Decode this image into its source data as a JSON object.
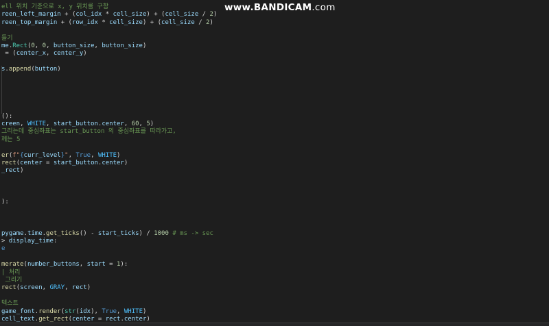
{
  "watermark": {
    "brand": "www.BANDICAM",
    "suffix": ".com"
  },
  "colors": {
    "background": "#1e1e1e",
    "keyword": "#c586c0",
    "function": "#dcdcaa",
    "variable": "#9cdcfe",
    "constant": "#4fc1ff",
    "number": "#b5cea8",
    "string": "#ce9178",
    "comment": "#6a9955",
    "bool": "#569cd6"
  },
  "code_lines": [
    {
      "segments": [
        {
          "t": "ell 위치 기준으로 x, y 위치를 구함",
          "c": "cmt"
        }
      ]
    },
    {
      "segments": [
        {
          "t": "reen_left_margin",
          "c": "var"
        },
        {
          "t": " + (",
          "c": "op"
        },
        {
          "t": "col_idx",
          "c": "var"
        },
        {
          "t": " * ",
          "c": "op"
        },
        {
          "t": "cell_size",
          "c": "var"
        },
        {
          "t": ") + (",
          "c": "op"
        },
        {
          "t": "cell_size",
          "c": "var"
        },
        {
          "t": " / ",
          "c": "op"
        },
        {
          "t": "2",
          "c": "num"
        },
        {
          "t": ")",
          "c": "op"
        }
      ]
    },
    {
      "segments": [
        {
          "t": "reen_top_margin",
          "c": "var"
        },
        {
          "t": " + (",
          "c": "op"
        },
        {
          "t": "row_idx",
          "c": "var"
        },
        {
          "t": " * ",
          "c": "op"
        },
        {
          "t": "cell_size",
          "c": "var"
        },
        {
          "t": ") + (",
          "c": "op"
        },
        {
          "t": "cell_size",
          "c": "var"
        },
        {
          "t": " / ",
          "c": "op"
        },
        {
          "t": "2",
          "c": "num"
        },
        {
          "t": ")",
          "c": "op"
        }
      ]
    },
    {
      "segments": []
    },
    {
      "segments": [
        {
          "t": "들기",
          "c": "cmt"
        }
      ]
    },
    {
      "segments": [
        {
          "t": "me",
          "c": "var"
        },
        {
          "t": ".",
          "c": "op"
        },
        {
          "t": "Rect",
          "c": "cls"
        },
        {
          "t": "(",
          "c": "op"
        },
        {
          "t": "0",
          "c": "num"
        },
        {
          "t": ", ",
          "c": "op"
        },
        {
          "t": "0",
          "c": "num"
        },
        {
          "t": ", ",
          "c": "op"
        },
        {
          "t": "button_size",
          "c": "var"
        },
        {
          "t": ", ",
          "c": "op"
        },
        {
          "t": "button_size",
          "c": "var"
        },
        {
          "t": ")",
          "c": "op"
        }
      ]
    },
    {
      "segments": [
        {
          "t": " = (",
          "c": "op"
        },
        {
          "t": "center_x",
          "c": "var"
        },
        {
          "t": ", ",
          "c": "op"
        },
        {
          "t": "center_y",
          "c": "var"
        },
        {
          "t": ")",
          "c": "op"
        }
      ]
    },
    {
      "segments": []
    },
    {
      "segments": [
        {
          "t": "s",
          "c": "var"
        },
        {
          "t": ".",
          "c": "op"
        },
        {
          "t": "append",
          "c": "fn"
        },
        {
          "t": "(",
          "c": "op"
        },
        {
          "t": "button",
          "c": "var"
        },
        {
          "t": ")",
          "c": "op"
        }
      ]
    },
    {
      "segments": []
    },
    {
      "segments": []
    },
    {
      "segments": []
    },
    {
      "segments": []
    },
    {
      "segments": []
    },
    {
      "segments": [
        {
          "t": "():",
          "c": "op"
        }
      ]
    },
    {
      "segments": [
        {
          "t": "creen",
          "c": "var"
        },
        {
          "t": ", ",
          "c": "op"
        },
        {
          "t": "WHITE",
          "c": "const"
        },
        {
          "t": ", ",
          "c": "op"
        },
        {
          "t": "start_button",
          "c": "var"
        },
        {
          "t": ".",
          "c": "op"
        },
        {
          "t": "center",
          "c": "var"
        },
        {
          "t": ", ",
          "c": "op"
        },
        {
          "t": "60",
          "c": "num"
        },
        {
          "t": ", ",
          "c": "op"
        },
        {
          "t": "5",
          "c": "num"
        },
        {
          "t": ")",
          "c": "op"
        }
      ]
    },
    {
      "segments": [
        {
          "t": "그리는데 중심좌표는 start_button 의 중심좌표를 따라가고,",
          "c": "cmt"
        }
      ]
    },
    {
      "segments": [
        {
          "t": "께는 5",
          "c": "cmt"
        }
      ]
    },
    {
      "segments": []
    },
    {
      "segments": [
        {
          "t": "er",
          "c": "fn"
        },
        {
          "t": "(",
          "c": "op"
        },
        {
          "t": "f\"",
          "c": "str"
        },
        {
          "t": "{",
          "c": "bool"
        },
        {
          "t": "curr_level",
          "c": "var"
        },
        {
          "t": "}",
          "c": "bool"
        },
        {
          "t": "\"",
          "c": "str"
        },
        {
          "t": ", ",
          "c": "op"
        },
        {
          "t": "True",
          "c": "bool"
        },
        {
          "t": ", ",
          "c": "op"
        },
        {
          "t": "WHITE",
          "c": "const"
        },
        {
          "t": ")",
          "c": "op"
        }
      ]
    },
    {
      "segments": [
        {
          "t": "rect",
          "c": "fn"
        },
        {
          "t": "(",
          "c": "op"
        },
        {
          "t": "center",
          "c": "var"
        },
        {
          "t": " = ",
          "c": "op"
        },
        {
          "t": "start_button",
          "c": "var"
        },
        {
          "t": ".",
          "c": "op"
        },
        {
          "t": "center",
          "c": "var"
        },
        {
          "t": ")",
          "c": "op"
        }
      ]
    },
    {
      "segments": [
        {
          "t": "_rect",
          "c": "var"
        },
        {
          "t": ")",
          "c": "op"
        }
      ]
    },
    {
      "segments": []
    },
    {
      "segments": []
    },
    {
      "segments": []
    },
    {
      "segments": [
        {
          "t": "):",
          "c": "op"
        }
      ]
    },
    {
      "segments": []
    },
    {
      "segments": []
    },
    {
      "segments": []
    },
    {
      "segments": [
        {
          "t": "pygame",
          "c": "var"
        },
        {
          "t": ".",
          "c": "op"
        },
        {
          "t": "time",
          "c": "var"
        },
        {
          "t": ".",
          "c": "op"
        },
        {
          "t": "get_ticks",
          "c": "fn"
        },
        {
          "t": "() - ",
          "c": "op"
        },
        {
          "t": "start_ticks",
          "c": "var"
        },
        {
          "t": ") / ",
          "c": "op"
        },
        {
          "t": "1000",
          "c": "num"
        },
        {
          "t": " # ms -> sec",
          "c": "cmt"
        }
      ]
    },
    {
      "segments": [
        {
          "t": "> ",
          "c": "op"
        },
        {
          "t": "display_time",
          "c": "var"
        },
        {
          "t": ":",
          "c": "op"
        }
      ]
    },
    {
      "segments": [
        {
          "t": "e",
          "c": "bool"
        }
      ]
    },
    {
      "segments": []
    },
    {
      "segments": [
        {
          "t": "merate",
          "c": "fn"
        },
        {
          "t": "(",
          "c": "op"
        },
        {
          "t": "number_buttons",
          "c": "var"
        },
        {
          "t": ", ",
          "c": "op"
        },
        {
          "t": "start",
          "c": "var"
        },
        {
          "t": " = ",
          "c": "op"
        },
        {
          "t": "1",
          "c": "num"
        },
        {
          "t": "):",
          "c": "op"
        }
      ]
    },
    {
      "segments": [
        {
          "t": "| 처리",
          "c": "cmt"
        }
      ]
    },
    {
      "segments": [
        {
          "t": " 그리기",
          "c": "cmt"
        }
      ]
    },
    {
      "segments": [
        {
          "t": "rect",
          "c": "fn"
        },
        {
          "t": "(",
          "c": "op"
        },
        {
          "t": "screen",
          "c": "var"
        },
        {
          "t": ", ",
          "c": "op"
        },
        {
          "t": "GRAY",
          "c": "const"
        },
        {
          "t": ", ",
          "c": "op"
        },
        {
          "t": "rect",
          "c": "var"
        },
        {
          "t": ")",
          "c": "op"
        }
      ]
    },
    {
      "segments": []
    },
    {
      "segments": [
        {
          "t": "텍스트",
          "c": "cmt"
        }
      ]
    },
    {
      "segments": [
        {
          "t": "game_font",
          "c": "var"
        },
        {
          "t": ".",
          "c": "op"
        },
        {
          "t": "render",
          "c": "fn"
        },
        {
          "t": "(",
          "c": "op"
        },
        {
          "t": "str",
          "c": "cls"
        },
        {
          "t": "(",
          "c": "op"
        },
        {
          "t": "idx",
          "c": "var"
        },
        {
          "t": "), ",
          "c": "op"
        },
        {
          "t": "True",
          "c": "bool"
        },
        {
          "t": ", ",
          "c": "op"
        },
        {
          "t": "WHITE",
          "c": "const"
        },
        {
          "t": ")",
          "c": "op"
        }
      ]
    },
    {
      "segments": [
        {
          "t": "cell_text",
          "c": "var"
        },
        {
          "t": ".",
          "c": "op"
        },
        {
          "t": "get_rect",
          "c": "fn"
        },
        {
          "t": "(",
          "c": "op"
        },
        {
          "t": "center",
          "c": "var"
        },
        {
          "t": " = ",
          "c": "op"
        },
        {
          "t": "rect",
          "c": "var"
        },
        {
          "t": ".",
          "c": "op"
        },
        {
          "t": "center",
          "c": "var"
        },
        {
          "t": ")",
          "c": "op"
        }
      ]
    }
  ]
}
